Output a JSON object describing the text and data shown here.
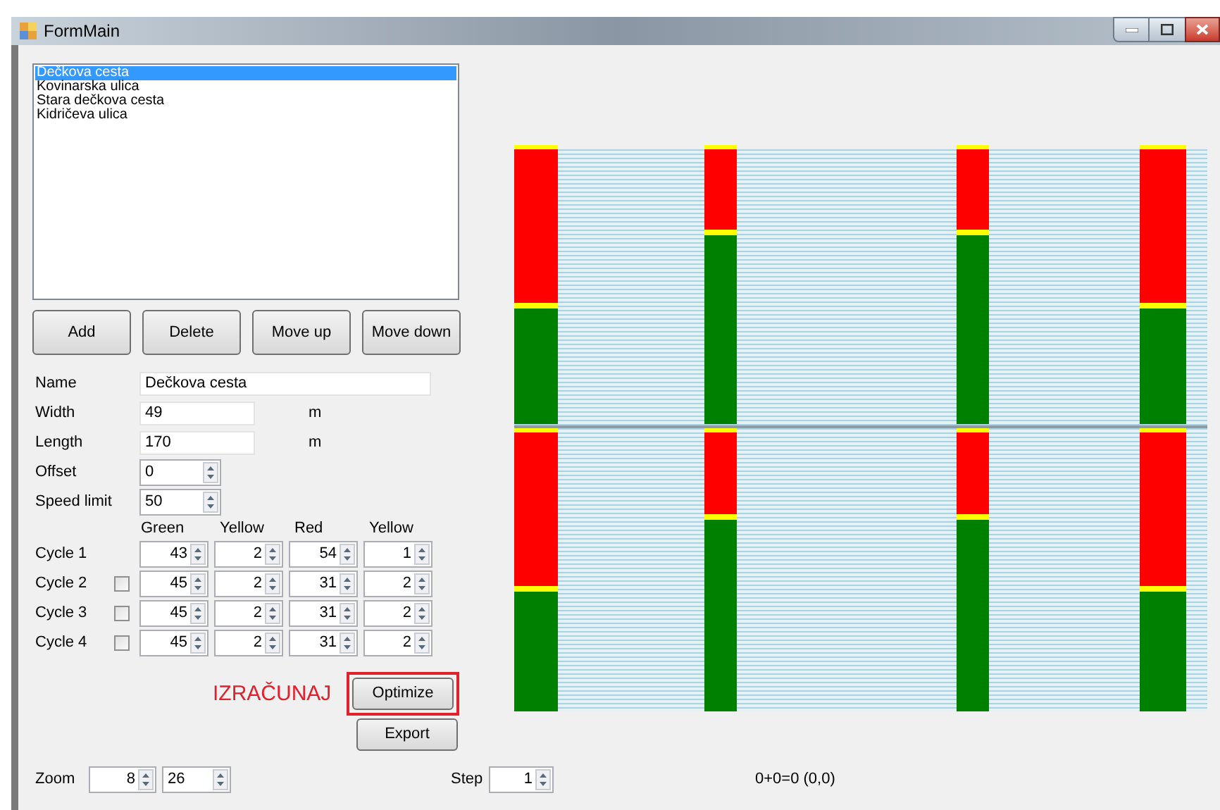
{
  "window": {
    "title": "FormMain"
  },
  "streets": [
    {
      "label": "Dečkova cesta",
      "selected": true
    },
    {
      "label": "Kovinarska ulica",
      "selected": false
    },
    {
      "label": "Stara dečkova cesta",
      "selected": false
    },
    {
      "label": "Kidričeva ulica",
      "selected": false
    }
  ],
  "list_buttons": [
    "Add",
    "Delete",
    "Move up",
    "Move down"
  ],
  "fields": [
    {
      "label": "Name",
      "value": "Dečkova cesta",
      "kind": "wide"
    },
    {
      "label": "Width",
      "value": "49",
      "unit": "m",
      "kind": "text"
    },
    {
      "label": "Length",
      "value": "170",
      "unit": "m",
      "kind": "text"
    },
    {
      "label": "Offset",
      "value": "0",
      "kind": "spinner"
    },
    {
      "label": "Speed limit",
      "value": "50",
      "kind": "spinner"
    }
  ],
  "cycle_headers": [
    "Green",
    "Yellow",
    "Red",
    "Yellow"
  ],
  "cycles": [
    {
      "label": "Cycle 1",
      "values": [
        "43",
        "2",
        "54",
        "1"
      ]
    },
    {
      "label": "Cycle 2",
      "checked": false,
      "values": [
        "45",
        "2",
        "31",
        "2"
      ]
    },
    {
      "label": "Cycle 3",
      "checked": false,
      "values": [
        "45",
        "2",
        "31",
        "2"
      ]
    },
    {
      "label": "Cycle 4",
      "checked": false,
      "values": [
        "45",
        "2",
        "31",
        "2"
      ]
    }
  ],
  "annotation": "IZRAČUNAJ",
  "optimize_button": {
    "label": "Optimize",
    "highlighted": true
  },
  "export_button": "Export",
  "zoom": {
    "label": "Zoom",
    "values": [
      "8",
      "26"
    ]
  },
  "step": {
    "label": "Step",
    "value": "1"
  },
  "status": "0+0=0 (0,0)"
}
